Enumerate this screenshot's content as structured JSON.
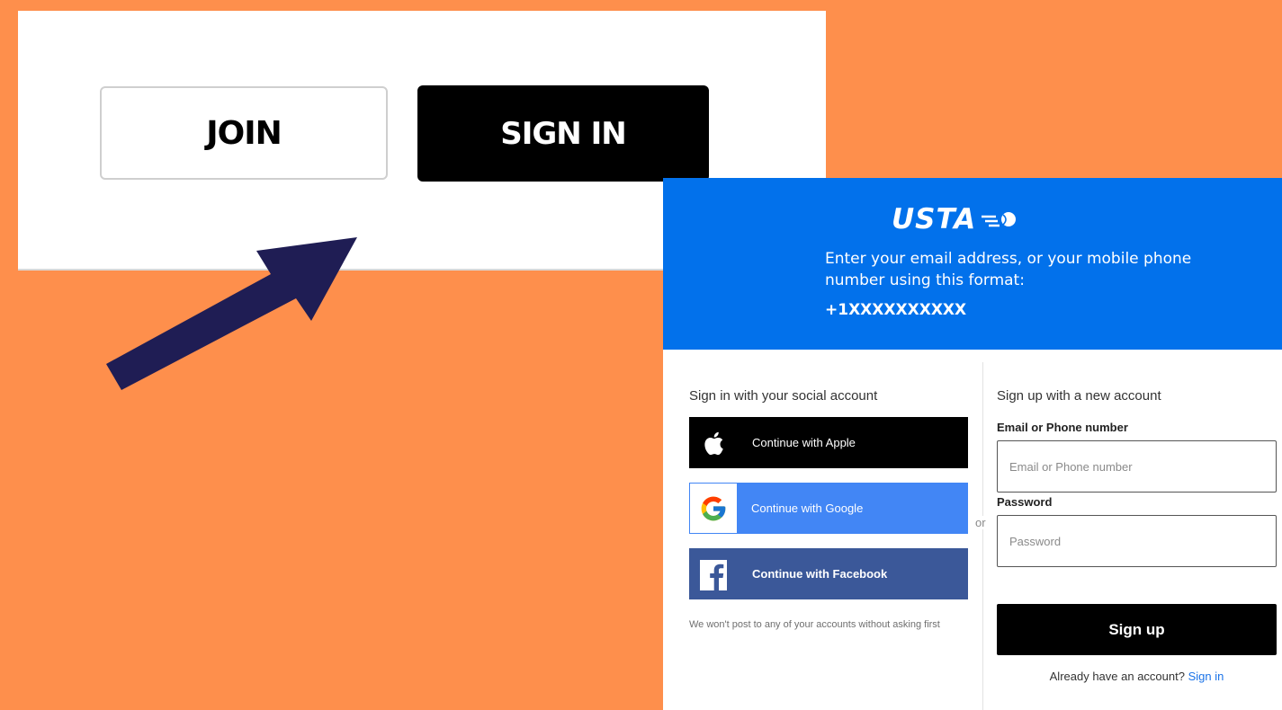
{
  "top_card": {
    "join_label": "JOIN",
    "signin_label": "SIGN IN"
  },
  "arrow": {
    "icon": "arrow-up-right-icon",
    "color": "#1f1d54"
  },
  "panel": {
    "logo_text": "USTA",
    "header_line": "Enter your email address, or your mobile phone number using this format:",
    "header_format": "+1XXXXXXXXXX",
    "header_color": "#0271eb",
    "social": {
      "title": "Sign in with your social account",
      "apple_label": "Continue with Apple",
      "google_label": "Continue with Google",
      "facebook_label": "Continue with Facebook",
      "note": "We won't post to any of your accounts without asking first"
    },
    "or_text": "or",
    "signup": {
      "title": "Sign up with a new account",
      "email_label": "Email or Phone number",
      "email_placeholder": "Email or Phone number",
      "password_label": "Password",
      "password_placeholder": "Password",
      "signup_button": "Sign up",
      "already_text": "Already have an account?",
      "signin_link": "Sign in"
    }
  },
  "colors": {
    "background": "#fe8f4c",
    "google_blue": "#4286f5",
    "facebook_blue": "#3b5899"
  }
}
